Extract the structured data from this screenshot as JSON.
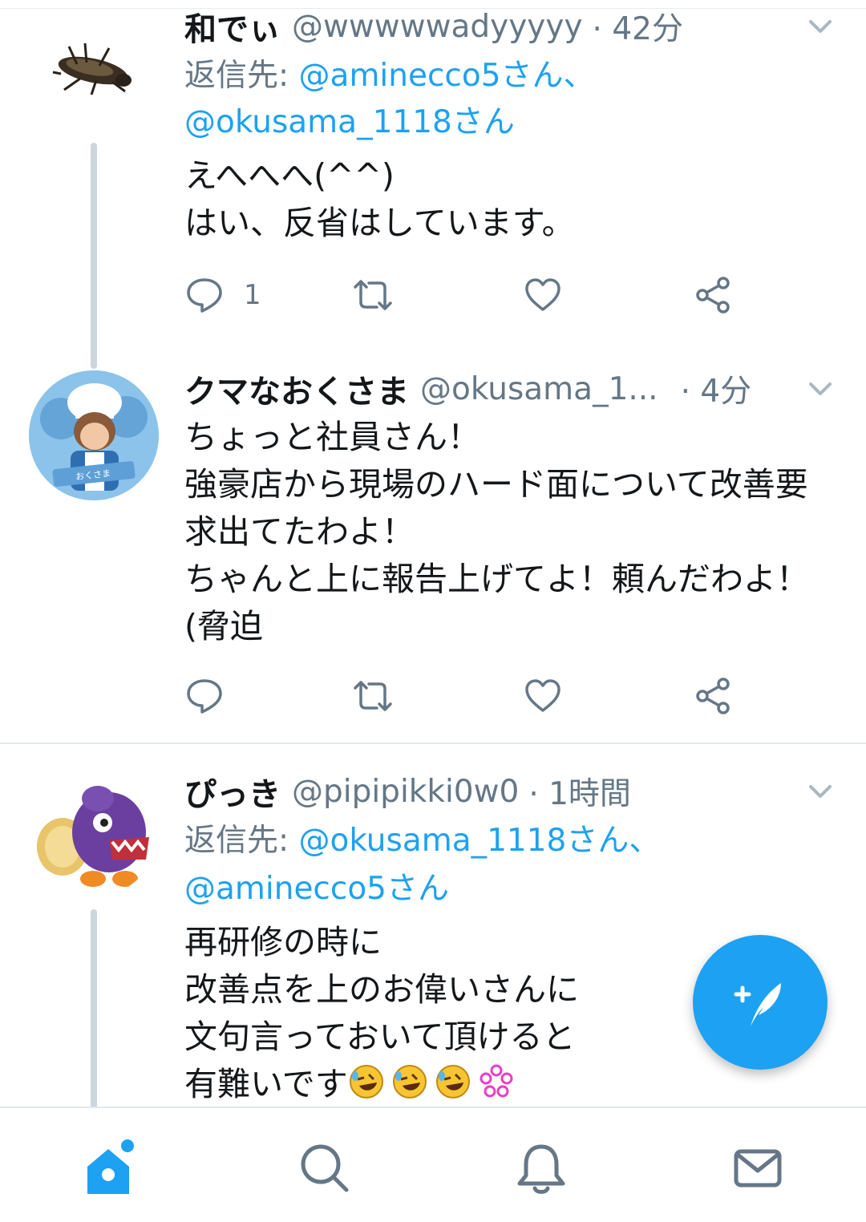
{
  "tweets": [
    {
      "name": "和でぃ",
      "handle": "@wwwwwadyyyyy",
      "time": "· 42分",
      "reply_prefix": "返信先: ",
      "reply_line1": "@aminecco5さん、",
      "reply_line2": "@okusama_1118さん",
      "text": "えへへへ(^^)\nはい、反省はしています。",
      "reply_count": "1",
      "avatar_icon": "cockroach-avatar-icon"
    },
    {
      "name": "クマなおくさま",
      "handle": "@okusama_1...",
      "time": "· 4分",
      "text": "ちょっと社員さん！\n強豪店から現場のハード面について改善要求出てたわよ！\nちゃんと上に報告上げてよ！頼んだわよ！(脅迫",
      "reply_count": "",
      "avatar_label": "おくさま",
      "avatar_icon": "chef-avatar-icon"
    },
    {
      "name": "ぴっき",
      "handle": "@pipipikki0w0",
      "time": "· 1時間",
      "reply_prefix": "返信先: ",
      "reply_line1": "@okusama_1118さん、",
      "reply_line2": "@aminecco5さん",
      "text": "再研修の時に\n改善点を上のお偉いさんに\n文句言っておいて頂けると\n有難いです",
      "reply_count": "",
      "avatar_icon": "character-avatar-icon",
      "trailing_emoji": [
        "rolling-on-floor-laughing",
        "rolling-on-floor-laughing",
        "rolling-on-floor-laughing",
        "pink-flower"
      ]
    }
  ],
  "fab": {
    "icon": "compose-tweet-icon"
  },
  "bottom_nav": [
    {
      "icon": "home-icon",
      "active": true
    },
    {
      "icon": "search-icon",
      "active": false
    },
    {
      "icon": "notifications-icon",
      "active": false
    },
    {
      "icon": "messages-icon",
      "active": false
    }
  ],
  "colors": {
    "accent": "#1da1f2",
    "text": "#14171a",
    "secondary": "#657786",
    "thread": "#ccd6dd"
  }
}
